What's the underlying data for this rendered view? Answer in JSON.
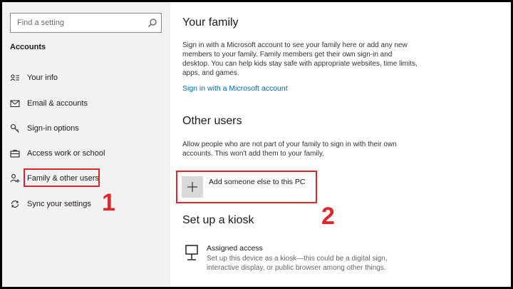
{
  "sidebar": {
    "search_placeholder": "Find a setting",
    "section_title": "Accounts",
    "items": [
      {
        "label": "Your info",
        "icon": "person-card-icon"
      },
      {
        "label": "Email & accounts",
        "icon": "envelope-icon"
      },
      {
        "label": "Sign-in options",
        "icon": "key-icon"
      },
      {
        "label": "Access work or school",
        "icon": "briefcase-icon"
      },
      {
        "label": "Family & other users",
        "icon": "person-add-icon"
      },
      {
        "label": "Sync your settings",
        "icon": "sync-icon"
      }
    ]
  },
  "main": {
    "your_family": {
      "heading": "Your family",
      "description": "Sign in with a Microsoft account to see your family here or add any new members to your family. Family members get their own sign-in and desktop. You can help kids stay safe with appropriate websites, time limits, apps, and games.",
      "link": "Sign in with a Microsoft account"
    },
    "other_users": {
      "heading": "Other users",
      "description": "Allow people who are not part of your family to sign in with their own accounts. This won't add them to your family.",
      "add_label": "Add someone else to this PC"
    },
    "kiosk": {
      "heading": "Set up a kiosk",
      "item_title": "Assigned access",
      "item_description": "Set up this device as a kiosk—this could be a digital sign, interactive display, or public browser among other things."
    }
  },
  "annotations": {
    "step1": "1",
    "step2": "2",
    "highlight_color": "#e0262b"
  },
  "colors": {
    "link": "#0067b8",
    "sidebar_bg": "#f2f2f2",
    "tile_bg": "#d9d9d9"
  }
}
